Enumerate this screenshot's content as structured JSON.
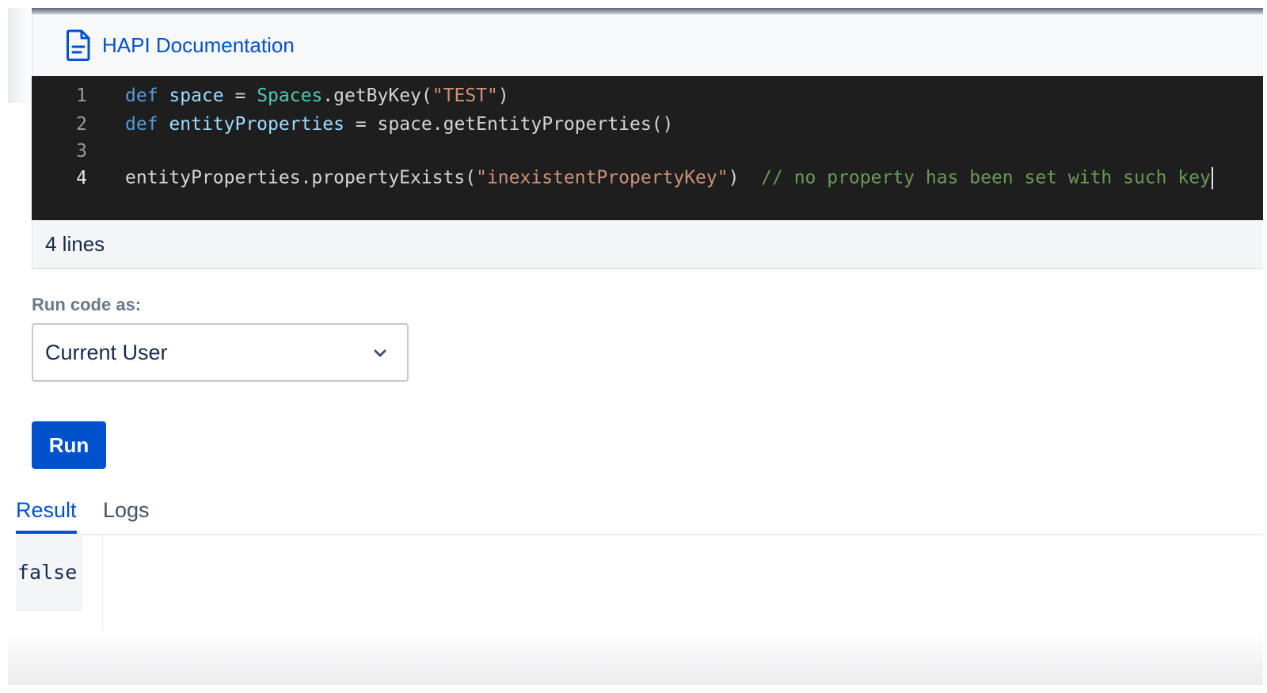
{
  "header": {
    "title": "HAPI Documentation",
    "icon": "document-icon"
  },
  "editor": {
    "lines": [
      {
        "number": "1",
        "tokens": [
          {
            "type": "kw",
            "text": "def"
          },
          {
            "type": "plain",
            "text": " "
          },
          {
            "type": "var",
            "text": "space"
          },
          {
            "type": "plain",
            "text": " = "
          },
          {
            "type": "cls",
            "text": "Spaces"
          },
          {
            "type": "plain",
            "text": ".getByKey("
          },
          {
            "type": "str",
            "text": "\"TEST\""
          },
          {
            "type": "plain",
            "text": ")"
          }
        ]
      },
      {
        "number": "2",
        "tokens": [
          {
            "type": "kw",
            "text": "def"
          },
          {
            "type": "plain",
            "text": " "
          },
          {
            "type": "var",
            "text": "entityProperties"
          },
          {
            "type": "plain",
            "text": " = space.getEntityProperties()"
          }
        ]
      },
      {
        "number": "3",
        "tokens": []
      },
      {
        "number": "4",
        "tokens": [
          {
            "type": "plain",
            "text": "entityProperties.propertyExists("
          },
          {
            "type": "str",
            "text": "\"inexistentPropertyKey\""
          },
          {
            "type": "plain",
            "text": ")  "
          },
          {
            "type": "com",
            "text": "// no property has been set with such key"
          }
        ]
      }
    ],
    "active_line": 4
  },
  "footer": {
    "line_count": "4 lines"
  },
  "run_as": {
    "label": "Run code as:",
    "selected": "Current User"
  },
  "run_button": {
    "label": "Run"
  },
  "tabs": {
    "result": "Result",
    "logs": "Logs"
  },
  "result": {
    "value": "false"
  },
  "colors": {
    "accent": "#0052cc",
    "editor_bg": "#1e1e1e"
  }
}
